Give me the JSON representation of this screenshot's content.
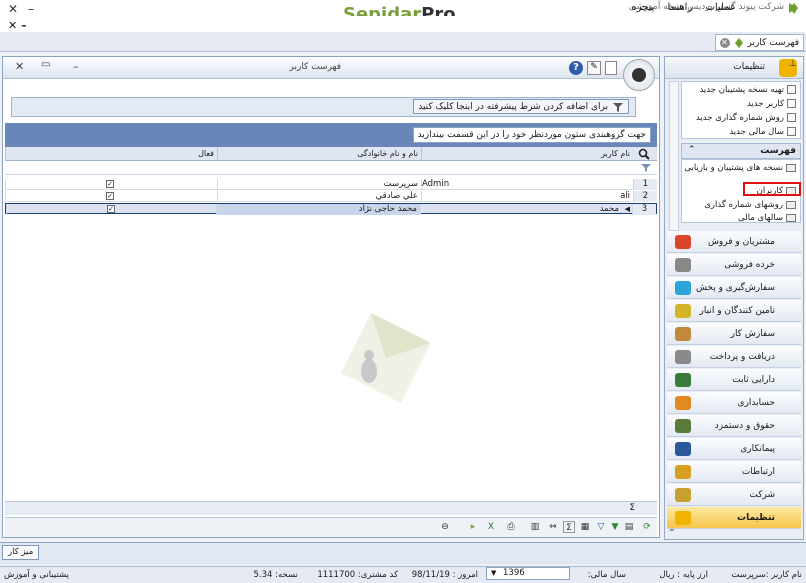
{
  "app": {
    "title": "شرکت پیوند گستر پردیس نسخه آموزشی",
    "brand_1": "Sepidar",
    "brand_2": "Pro"
  },
  "menu": {
    "items": [
      "عملیات",
      "راهنما",
      "پنجره"
    ]
  },
  "tabs": {
    "active_label": "فهرست کاربر"
  },
  "window": {
    "title": "فهرست کاربر",
    "filter_button": "برای اضافه کردن شرط پیشرفته در اینجا کلیک کنید",
    "group_hint": "جهت گروهبندی ستون موردنظر خود را در این قسمت بیندازید"
  },
  "grid": {
    "columns": [
      "نام کاربر",
      "نام و نام خانوادگی",
      "فعال"
    ],
    "rows": [
      {
        "num": "1",
        "user": "Admin",
        "name": "سرپرست",
        "active": true
      },
      {
        "num": "2",
        "user": "ali",
        "name": "علي صادقي",
        "active": true
      },
      {
        "num": "3",
        "user": "محمد",
        "name": "محمد حاجی نژاد",
        "active": true
      }
    ]
  },
  "sidebar": {
    "header": "تنظیمات",
    "quick_links": [
      "تهیه نسخه پشتیبان جدید",
      "کاربر جدید",
      "روش شماره گذاری جدید",
      "سال مالی جدید"
    ],
    "list_header": "فهرست",
    "list_items": [
      "نسخه های پشتیبان و بازیابی",
      "کاربران",
      "روشهای شماره گذاری",
      "سالهای مالی"
    ],
    "modules": [
      {
        "label": "مشتریان و فروش",
        "color": "#d9462b"
      },
      {
        "label": "خرده فروشی",
        "color": "#888888"
      },
      {
        "label": "سفارش‌گیری و پخش",
        "color": "#2aa5d8"
      },
      {
        "label": "تامین کنندگان و انبار",
        "color": "#d4b52a"
      },
      {
        "label": "سفارش کار",
        "color": "#c08a3a"
      },
      {
        "label": "دریافت و پرداخت",
        "color": "#8a8a8a"
      },
      {
        "label": "دارایی ثابت",
        "color": "#3a7a3a"
      },
      {
        "label": "حسابداری",
        "color": "#e08a20"
      },
      {
        "label": "حقوق و دستمزد",
        "color": "#5a7a3a"
      },
      {
        "label": "پیمانکاری",
        "color": "#2a5a9a"
      },
      {
        "label": "ارتباطات",
        "color": "#d8a020"
      },
      {
        "label": "شرکت",
        "color": "#c8a030"
      },
      {
        "label": "تنظیمات",
        "color": "#f0b400"
      }
    ]
  },
  "desktop": {
    "button": "میز کار"
  },
  "status": {
    "user": "نام کاربر :سرپرست",
    "base_currency": "ارز پایه : ریال",
    "fiscal_year_label": "سال مالی:",
    "fiscal_year": "1396",
    "today": "امروز : 98/11/19",
    "customer_code": "کد مشتری: 1111700",
    "version": "نسخه: 5.34",
    "support": "پشتیبانی و آموزش"
  }
}
